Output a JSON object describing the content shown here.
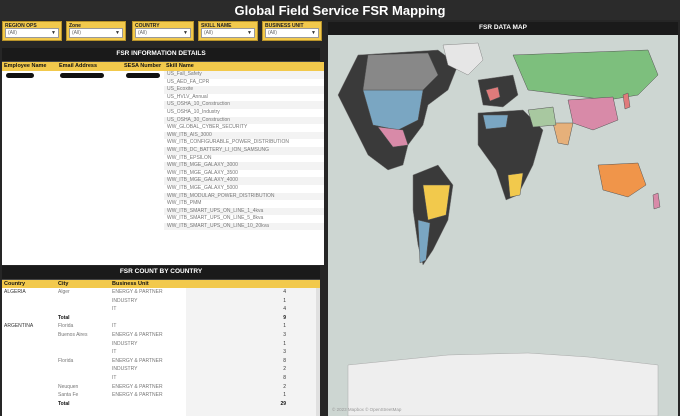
{
  "title": "Global Field Service FSR Mapping",
  "filters": [
    {
      "label": "REGION OPS",
      "value": "(All)"
    },
    {
      "label": "Zone",
      "value": "(All)"
    },
    {
      "label": "COUNTRY",
      "value": "(All)"
    },
    {
      "label": "SKILL NAME",
      "value": "(All)"
    },
    {
      "label": "BUSINESS UNIT",
      "value": "(All)"
    }
  ],
  "info_panel": {
    "title": "FSR INFORMATION DETAILS",
    "columns": [
      "Employee Name",
      "Email Address",
      "SESA Number",
      "Skill Name"
    ],
    "skills": [
      "US_Fall_Safety",
      "US_AED_FA_CPR",
      "US_Ecoxite",
      "US_HVLV_Annual",
      "US_OSHA_10_Construction",
      "US_OSHA_10_Industry",
      "US_OSHA_30_Construction",
      "WW_GLOBAL_CYBER_SECURITY",
      "WW_ITB_AIS_3000",
      "WW_ITB_CONFIGURABLE_POWER_DISTRIBUTION",
      "WW_ITB_DC_BATTERY_LI_ION_SAMSUNG",
      "WW_ITB_EPSILON",
      "WW_ITB_MGE_GALAXY_3000",
      "WW_ITB_MGE_GALAXY_3500",
      "WW_ITB_MGE_GALAXY_4000",
      "WW_ITB_MGE_GALAXY_5000",
      "WW_ITB_MODULAR_POWER_DISTRIBUTION",
      "WW_ITB_PMM",
      "WW_ITB_SMART_UPS_ON_LINE_1_4kva",
      "WW_ITB_SMART_UPS_ON_LINE_5_8kva",
      "WW_ITB_SMART_UPS_ON_LINE_10_20kva"
    ]
  },
  "count_panel": {
    "title": "FSR COUNT BY COUNTRY",
    "columns": [
      "Country",
      "City",
      "Business Unit",
      ""
    ],
    "rows": [
      {
        "country": "ALGERIA",
        "city": "Alger",
        "unit": "ENERGY & PARTNER",
        "count": "4"
      },
      {
        "country": "",
        "city": "",
        "unit": "INDUSTRY",
        "count": "1"
      },
      {
        "country": "",
        "city": "",
        "unit": "IT",
        "count": "4"
      },
      {
        "country": "",
        "city": "Total",
        "unit": "",
        "count": "9",
        "total": true
      },
      {
        "country": "ARGENTINA",
        "city": "Florida",
        "unit": "IT",
        "count": "1"
      },
      {
        "country": "",
        "city": "Buenos Aires",
        "unit": "ENERGY & PARTNER",
        "count": "3"
      },
      {
        "country": "",
        "city": "",
        "unit": "INDUSTRY",
        "count": "1"
      },
      {
        "country": "",
        "city": "",
        "unit": "IT",
        "count": "3"
      },
      {
        "country": "",
        "city": "Florida",
        "unit": "ENERGY & PARTNER",
        "count": "8"
      },
      {
        "country": "",
        "city": "",
        "unit": "INDUSTRY",
        "count": "2"
      },
      {
        "country": "",
        "city": "",
        "unit": "IT",
        "count": "8"
      },
      {
        "country": "",
        "city": "Neuquen",
        "unit": "ENERGY & PARTNER",
        "count": "2"
      },
      {
        "country": "",
        "city": "Santa Fe",
        "unit": "ENERGY & PARTNER",
        "count": "1"
      },
      {
        "country": "",
        "city": "Total",
        "unit": "",
        "count": "29",
        "total": true
      }
    ]
  },
  "map_panel": {
    "title": "FSR DATA MAP",
    "credit": "© 2023 Mapbox © OpenStreetMap",
    "ocean_color": "#cdd6d2",
    "land_color": "#2f2f2f"
  }
}
